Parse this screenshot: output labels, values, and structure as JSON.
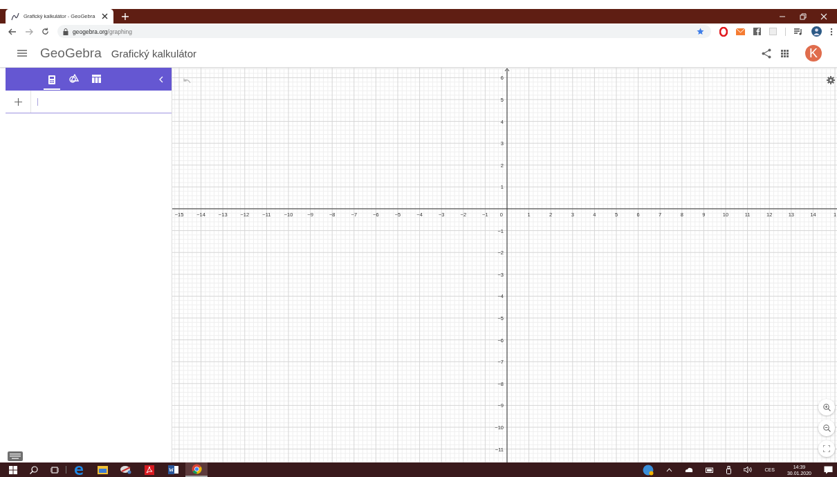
{
  "browser": {
    "tab_title": "Grafický kalkulátor - GeoGebra",
    "url_host": "geogebra.org",
    "url_path": "/graphing"
  },
  "app": {
    "logo": "GeoGebra",
    "title": "Grafický kalkulátor",
    "avatar": "K"
  },
  "sidebar": {
    "tabs": [
      {
        "kind": "algebra",
        "selected": true
      },
      {
        "kind": "tools",
        "selected": false
      },
      {
        "kind": "table",
        "selected": false
      }
    ]
  },
  "graph": {
    "x_labels": [
      "−15",
      "−14",
      "−13",
      "−12",
      "−11",
      "−10",
      "−9",
      "−8",
      "−7",
      "−6",
      "−5",
      "−4",
      "−3",
      "−2",
      "−1",
      "0",
      "1",
      "2",
      "3",
      "4",
      "5",
      "6",
      "7",
      "8",
      "9",
      "10",
      "11",
      "12",
      "13",
      "14",
      "1"
    ],
    "y_labels": [
      "6",
      "5",
      "4",
      "3",
      "2",
      "1",
      "−1",
      "−2",
      "−3",
      "−4",
      "−5",
      "−6",
      "−7",
      "−8",
      "−9",
      "−10",
      "−11"
    ]
  },
  "taskbar": {
    "apps": [
      {
        "kind": "edge",
        "selected": false
      },
      {
        "kind": "folder",
        "selected": false
      },
      {
        "kind": "tool",
        "selected": false
      },
      {
        "kind": "pdf",
        "selected": false
      },
      {
        "kind": "word",
        "selected": false
      },
      {
        "kind": "chrome",
        "selected": true
      }
    ],
    "language": "CES",
    "time": "14:39",
    "date": "30.01.2020"
  }
}
